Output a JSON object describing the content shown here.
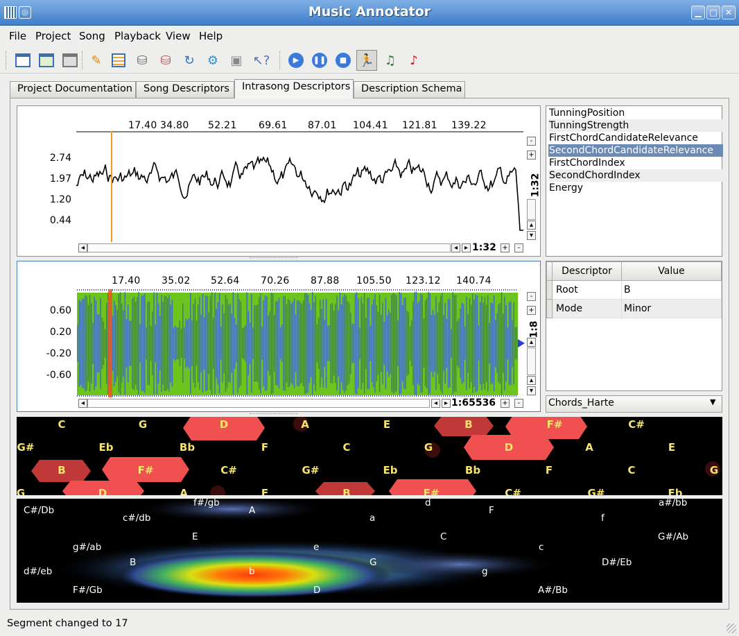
{
  "window": {
    "title": "Music Annotator"
  },
  "menu": [
    "File",
    "Project",
    "Song",
    "Playback",
    "View",
    "Help"
  ],
  "tabs": [
    "Project Documentation",
    "Song Descriptors",
    "Intrasong Descriptors",
    "Description Schema"
  ],
  "active_tab": "Intrasong Descriptors",
  "plot1": {
    "x_ticks": [
      "17.40",
      "34.80",
      "52.21",
      "69.61",
      "87.01",
      "104.41",
      "121.81",
      "139.22"
    ],
    "y_ticks": [
      "2.74",
      "1.97",
      "1.20",
      "0.44"
    ],
    "zoom_v": "1:32",
    "zoom_h": "1:32"
  },
  "plot2": {
    "x_ticks": [
      "17.40",
      "35.02",
      "52.64",
      "70.26",
      "87.88",
      "105.50",
      "123.12",
      "140.74"
    ],
    "y_ticks": [
      "0.60",
      "0.20",
      "-0.20",
      "-0.60"
    ],
    "zoom_v": "1:8",
    "zoom_h": "1:65536"
  },
  "descriptor_list": [
    "TunningPosition",
    "TunningStrength",
    "FirstChordCandidateRelevance",
    "SecondChordCandidateRelevance",
    "FirstChordIndex",
    "SecondChordIndex",
    "Energy"
  ],
  "descriptor_selected": "SecondChordCandidateRelevance",
  "value_table": {
    "headers": [
      "Descriptor",
      "Value"
    ],
    "rows": [
      [
        "Root",
        "B"
      ],
      [
        "Mode",
        "Minor"
      ]
    ]
  },
  "schema_select": "Chords_Harte",
  "tonnetz_rows": [
    [
      "C",
      "G",
      "D",
      "A",
      "E",
      "B",
      "F#",
      "C#"
    ],
    [
      "G#",
      "Eb",
      "Bb",
      "F",
      "C",
      "G",
      "D",
      "A",
      "E"
    ],
    [
      "B",
      "F#",
      "C#",
      "G#",
      "Eb",
      "Bb",
      "F",
      "C",
      "G"
    ],
    [
      "G",
      "D",
      "A",
      "E",
      "B",
      "F#",
      "C#",
      "G#",
      "Eb"
    ]
  ],
  "keyspace_labels": [
    "f#/gb",
    "d",
    "a#/bb",
    "C#/Db",
    "c#/db",
    "A",
    "a",
    "F",
    "f",
    "E",
    "C",
    "G#/Ab",
    "g#/ab",
    "e",
    "c",
    "B",
    "G",
    "D#/Eb",
    "d#/eb",
    "b",
    "g",
    "F#/Gb",
    "D",
    "A#/Bb"
  ],
  "status": "Segment changed to 17",
  "icons": [
    "new-project-icon",
    "open-project-icon",
    "save-project-icon",
    "edit-icon",
    "properties-icon",
    "add-database-icon",
    "database-icon",
    "refresh-icon",
    "settings-icon",
    "save-icon",
    "whats-this-icon",
    "play-icon",
    "pause-icon",
    "stop-icon",
    "follow-icon",
    "song-icon",
    "annotate-icon"
  ]
}
